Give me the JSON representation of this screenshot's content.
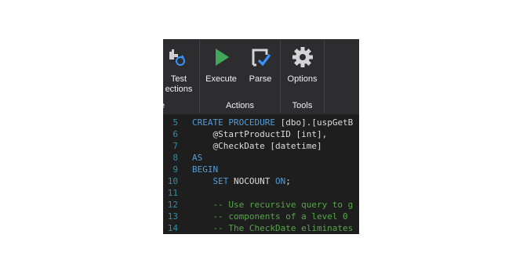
{
  "ribbon": {
    "test_connections": {
      "line1": "Test",
      "line2": "ections",
      "icon": "test-connection-icon"
    },
    "partial_group_label": "e",
    "actions_group": {
      "label": "Actions",
      "execute": {
        "label": "Execute",
        "icon": "play-icon",
        "color": "#3fa85a"
      },
      "parse": {
        "label": "Parse",
        "icon": "parse-check-icon",
        "color": "#3794ff"
      }
    },
    "tools_group": {
      "label": "Tools",
      "options": {
        "label": "Options",
        "icon": "gear-icon"
      }
    }
  },
  "editor": {
    "lines": [
      {
        "num": "5",
        "parts": [
          {
            "t": "CREATE PROCEDURE",
            "c": "kw"
          },
          {
            "t": " [dbo].[uspGetB",
            "c": ""
          }
        ]
      },
      {
        "num": "6",
        "parts": [
          {
            "t": "    @StartProductID [int],",
            "c": ""
          }
        ]
      },
      {
        "num": "7",
        "parts": [
          {
            "t": "    @CheckDate [datetime]",
            "c": ""
          }
        ]
      },
      {
        "num": "8",
        "parts": [
          {
            "t": "AS",
            "c": "kw"
          }
        ]
      },
      {
        "num": "9",
        "parts": [
          {
            "t": "BEGIN",
            "c": "kw"
          }
        ]
      },
      {
        "num": "10",
        "parts": [
          {
            "t": "    ",
            "c": ""
          },
          {
            "t": "SET",
            "c": "kw"
          },
          {
            "t": " NOCOUNT ",
            "c": ""
          },
          {
            "t": "ON",
            "c": "kw"
          },
          {
            "t": ";",
            "c": ""
          }
        ]
      },
      {
        "num": "11",
        "parts": []
      },
      {
        "num": "12",
        "parts": [
          {
            "t": "    -- Use recursive query to g",
            "c": "cm"
          }
        ]
      },
      {
        "num": "13",
        "parts": [
          {
            "t": "    -- components of a level 0",
            "c": "cm"
          }
        ]
      },
      {
        "num": "14",
        "parts": [
          {
            "t": "    -- The CheckDate eliminates",
            "c": "cm"
          }
        ]
      }
    ]
  }
}
